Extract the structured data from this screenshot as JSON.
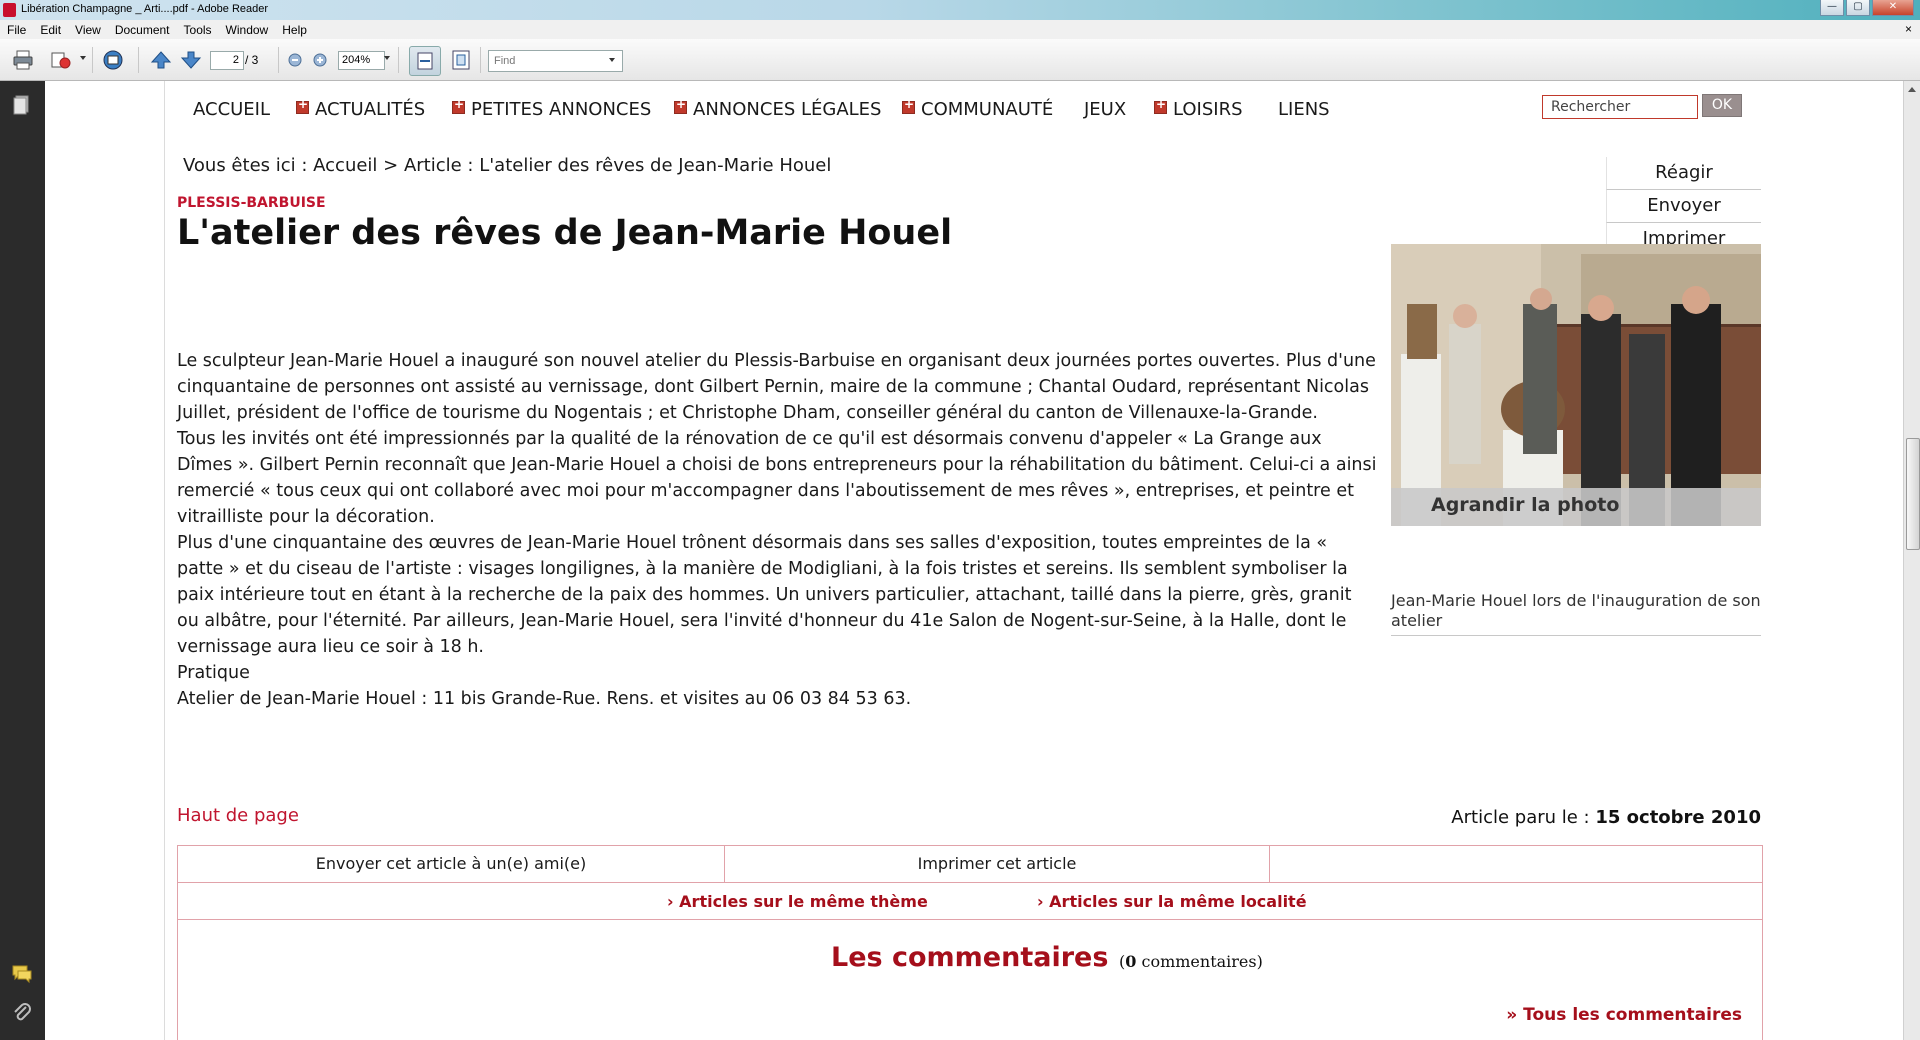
{
  "window": {
    "title": "Libération Champagne _ Arti....pdf - Adobe Reader",
    "controls": {
      "minimize": "—",
      "maximize": "▢",
      "close": "✕"
    }
  },
  "menu": {
    "items": [
      "File",
      "Edit",
      "View",
      "Document",
      "Tools",
      "Window",
      "Help"
    ],
    "close_doc": "×"
  },
  "toolbar": {
    "current_page": "2",
    "total_pages": "/ 3",
    "zoom": "204%",
    "find_placeholder": "Find",
    "icons": [
      "print-icon",
      "share-icon",
      "collaborate-icon",
      "previous-page-icon",
      "next-page-icon",
      "zoom-out-icon",
      "zoom-in-icon",
      "fit-width-icon",
      "fit-page-icon"
    ]
  },
  "left_panel": {
    "icons": [
      "pages-icon",
      "comments-icon",
      "attachments-icon"
    ]
  },
  "site": {
    "nav": [
      {
        "label": "ACCUEIL",
        "plus": false
      },
      {
        "label": "ACTUALITÉS",
        "plus": true
      },
      {
        "label": "PETITES ANNONCES",
        "plus": true
      },
      {
        "label": "ANNONCES LÉGALES",
        "plus": true
      },
      {
        "label": "COMMUNAUTÉ",
        "plus": true
      },
      {
        "label": "JEUX",
        "plus": false
      },
      {
        "label": "LOISIRS",
        "plus": true
      },
      {
        "label": "LIENS",
        "plus": false
      }
    ],
    "search_placeholder": "Rechercher",
    "search_button": "OK"
  },
  "article": {
    "breadcrumb": "Vous êtes ici : Accueil > Article : L'atelier des rêves de Jean-Marie Houel",
    "category": "PLESSIS-BARBUISE",
    "title": "L'atelier des rêves de Jean-Marie Houel",
    "actions": [
      "Réagir",
      "Envoyer",
      "Imprimer"
    ],
    "photo_overlay": "Agrandir la photo",
    "photo_caption": "Jean-Marie Houel lors de l'inauguration de son atelier",
    "paragraphs": [
      "Le sculpteur Jean-Marie Houel a inauguré son nouvel atelier du Plessis-Barbuise en organisant deux journées portes ouvertes. Plus d'une cinquantaine de personnes ont assisté au vernissage, dont Gilbert Pernin, maire de la commune ; Chantal Oudard, représentant Nicolas Juillet, président de l'office de tourisme du Nogentais ; et Christophe Dham, conseiller général du canton de Villenauxe-la-Grande.",
      "Tous les invités ont été impressionnés par la qualité de la rénovation de ce qu'il est désormais convenu d'appeler « La Grange aux Dîmes ». Gilbert Pernin reconnaît que Jean-Marie Houel a choisi de bons entrepreneurs pour la réhabilitation du bâtiment. Celui-ci a ainsi remercié « tous ceux qui ont collaboré avec moi pour m'accompagner dans l'aboutissement de mes rêves », entreprises, et peintre et vitrailliste pour la décoration.",
      "Plus d'une cinquantaine des œuvres de Jean-Marie Houel trônent désormais dans ses salles d'exposition, toutes empreintes de la « patte » et du ciseau de l'artiste : visages longilignes, à la manière de Modigliani, à la fois tristes et sereins. Ils semblent symboliser la paix intérieure tout en étant à la recherche de la paix des hommes. Un univers particulier, attachant, taillé dans la pierre, grès, granit ou albâtre, pour l'éternité. Par ailleurs, Jean-Marie Houel, sera l'invité d'honneur du 41e Salon de Nogent-sur-Seine, à la Halle, dont le vernissage aura lieu ce soir à 18 h.",
      "Pratique",
      "Atelier de Jean-Marie Houel : 11 bis Grande-Rue. Rens. et visites au 06 03 84 53 63."
    ],
    "top_link": "Haut de page",
    "published_label": "Article paru le : ",
    "published_date": "15 octobre 2010"
  },
  "footer": {
    "send_friend": "Envoyer cet article à un(e) ami(e)",
    "print_article": "Imprimer cet article",
    "same_theme": "› Articles sur le même thème",
    "same_locality": "› Articles sur la même localité",
    "comments_title": "Les commentaires",
    "comments_count_prefix": "(",
    "comments_count": "0",
    "comments_count_suffix": " commentaires)",
    "all_comments": "» Tous les commentaires"
  },
  "colors": {
    "accent_red": "#c0152f",
    "dark_red": "#a50f1b",
    "panel_dark": "#2b2b2b"
  }
}
